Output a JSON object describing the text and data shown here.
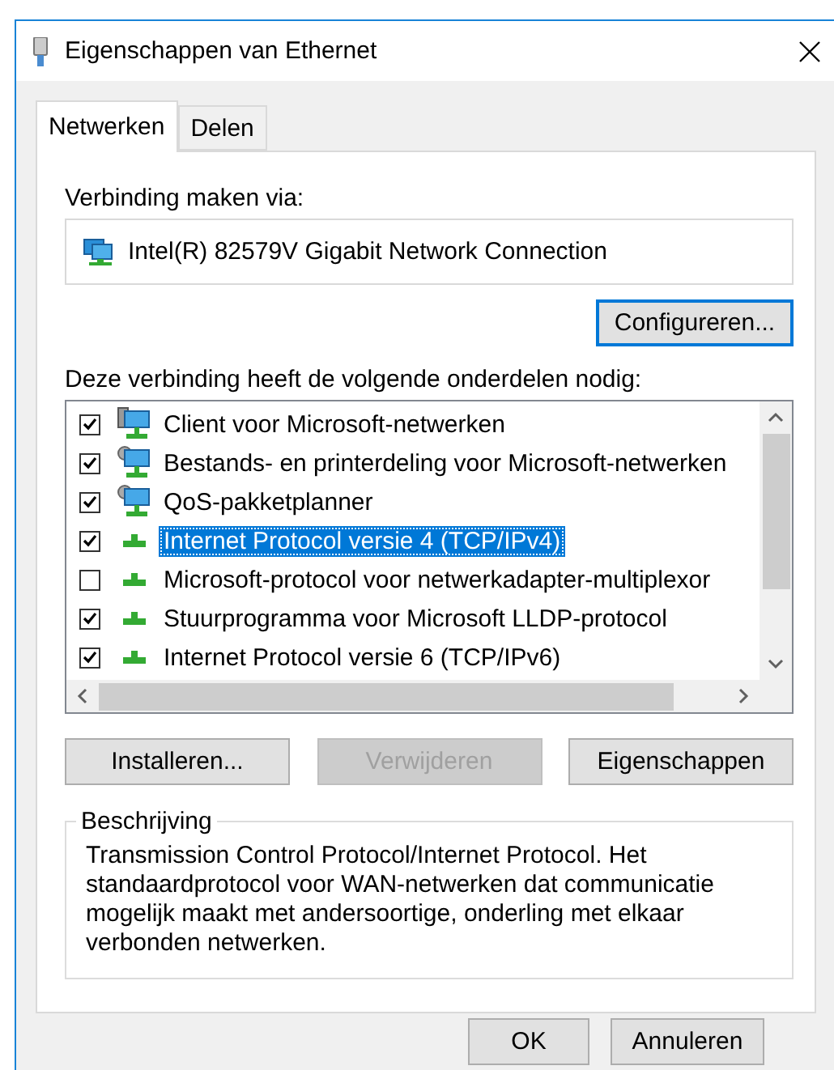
{
  "window": {
    "title": "Eigenschappen van Ethernet"
  },
  "tabs": [
    {
      "label": "Netwerken",
      "selected": true
    },
    {
      "label": "Delen",
      "selected": false
    }
  ],
  "connect_via": {
    "label": "Verbinding maken via:",
    "adapter": "Intel(R) 82579V Gigabit Network Connection",
    "configure_button": "Configureren..."
  },
  "components": {
    "label": "Deze verbinding heeft de volgende onderdelen nodig:",
    "items": [
      {
        "label": "Client voor Microsoft-netwerken",
        "kind": "client",
        "checked": true,
        "selected": false
      },
      {
        "label": "Bestands- en printerdeling voor Microsoft-netwerken",
        "kind": "service",
        "checked": true,
        "selected": false
      },
      {
        "label": "QoS-pakketplanner",
        "kind": "service",
        "checked": true,
        "selected": false
      },
      {
        "label": "Internet Protocol versie 4 (TCP/IPv4)",
        "kind": "protocol",
        "checked": true,
        "selected": true
      },
      {
        "label": "Microsoft-protocol voor netwerkadapter-multiplexor",
        "kind": "protocol",
        "checked": false,
        "selected": false
      },
      {
        "label": "Stuurprogramma voor Microsoft LLDP-protocol",
        "kind": "protocol",
        "checked": true,
        "selected": false
      },
      {
        "label": "Internet Protocol versie 6 (TCP/IPv6)",
        "kind": "protocol",
        "checked": true,
        "selected": false
      }
    ]
  },
  "actions": [
    {
      "label": "Installeren...",
      "disabled": false
    },
    {
      "label": "Verwijderen",
      "disabled": true
    },
    {
      "label": "Eigenschappen",
      "disabled": false
    }
  ],
  "description": {
    "title": "Beschrijving",
    "text": "Transmission Control Protocol/Internet Protocol. Het standaardprotocol voor WAN-netwerken dat communicatie mogelijk maakt met andersoortige, onderling met elkaar verbonden netwerken."
  },
  "dialog_buttons": [
    {
      "label": "OK"
    },
    {
      "label": "Annuleren"
    }
  ]
}
